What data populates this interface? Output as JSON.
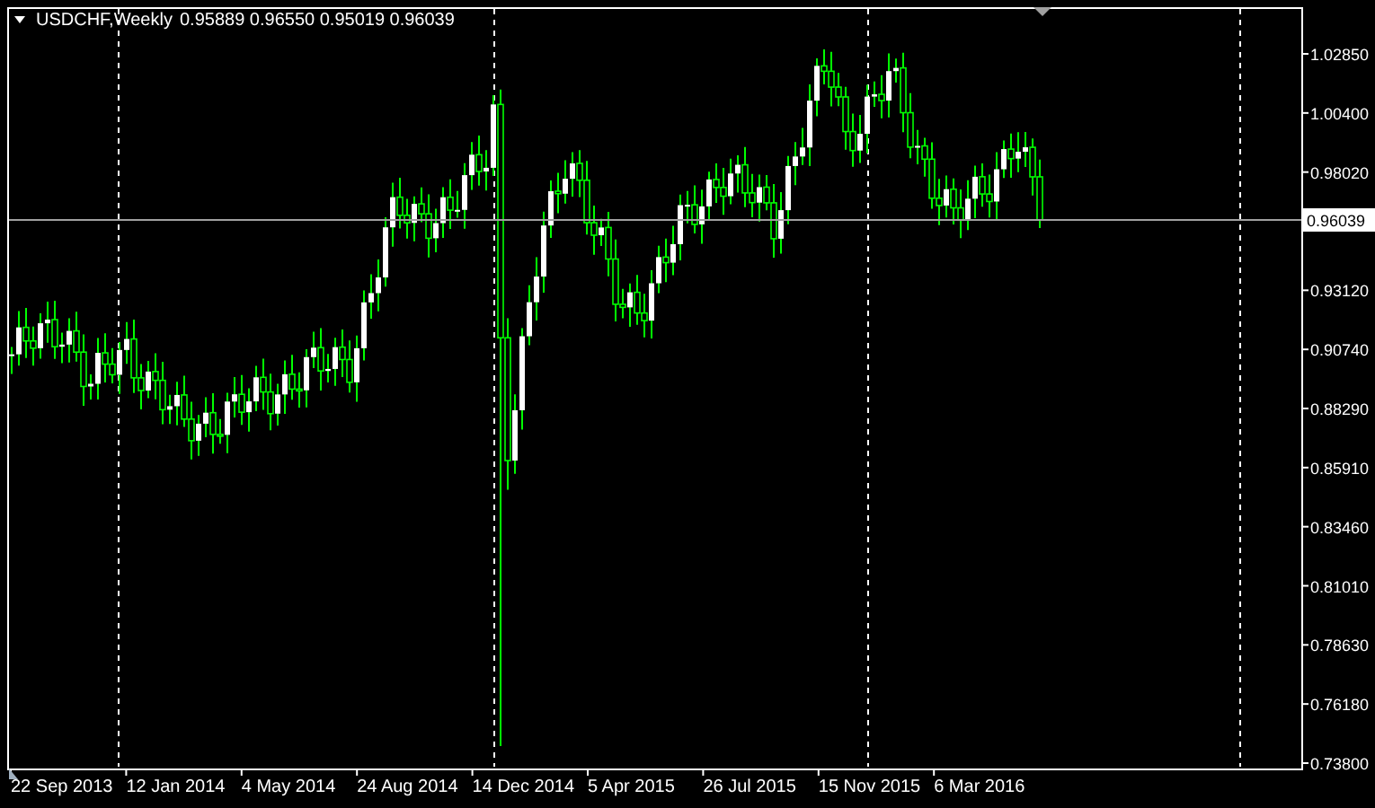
{
  "header": {
    "symbol": "USDCHF,Weekly",
    "values": "0.95889 0.96550 0.95019 0.96039"
  },
  "price_axis": {
    "ticks": [
      "1.02850",
      "1.00400",
      "0.98020",
      "0.93120",
      "0.90740",
      "0.88290",
      "0.85910",
      "0.83460",
      "0.81010",
      "0.78630",
      "0.76180",
      "0.73800"
    ],
    "current_price": "0.96039"
  },
  "time_axis": {
    "ticks": [
      "22 Sep 2013",
      "12 Jan 2014",
      "4 May 2014",
      "24 Aug 2014",
      "14 Dec 2014",
      "5 Apr 2015",
      "26 Jul 2015",
      "15 Nov 2015",
      "6 Mar 2016"
    ]
  }
}
